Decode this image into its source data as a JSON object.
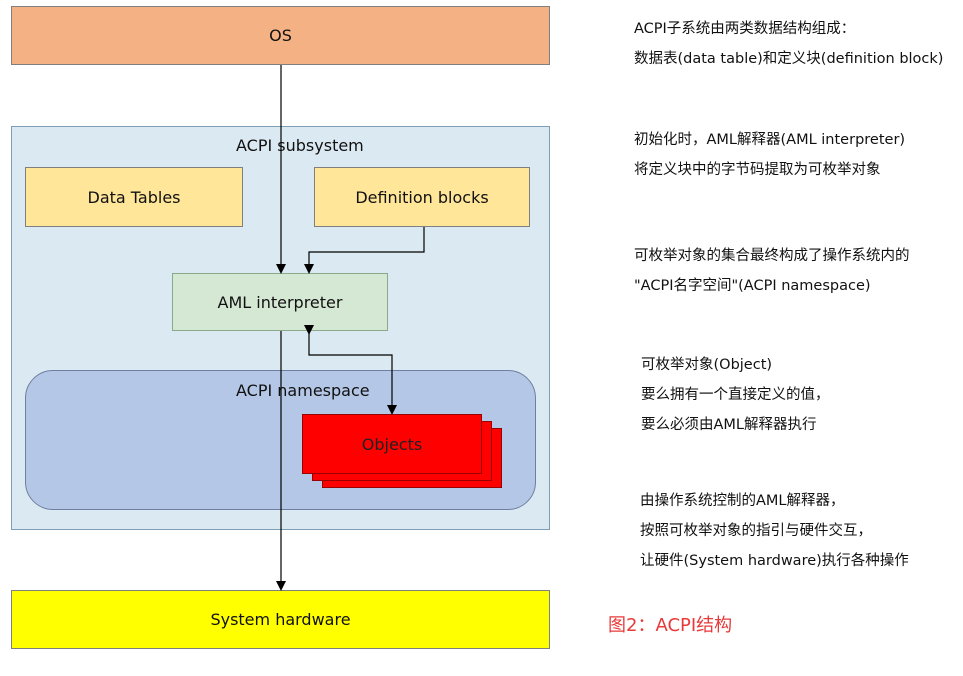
{
  "diagram": {
    "os_label": "OS",
    "subsystem_label": "ACPI subsystem",
    "data_tables_label": "Data Tables",
    "definition_blocks_label": "Definition blocks",
    "aml_interpreter_label": "AML interpreter",
    "namespace_label": "ACPI namespace",
    "objects_label": "Objects",
    "hardware_label": "System hardware",
    "colors": {
      "os": "#f4b183",
      "subsystem": "#dbeaf2",
      "tables": "#ffe699",
      "interpreter": "#d5e8d4",
      "namespace": "#b4c7e7",
      "objects": "#ff0000",
      "hardware": "#ffff00"
    }
  },
  "notes": [
    [
      "ACPI子系统由两类数据结构组成：",
      "数据表(data table)和定义块(definition block)"
    ],
    [
      "初始化时，AML解释器(AML interpreter)",
      "将定义块中的字节码提取为可枚举对象"
    ],
    [
      "可枚举对象的集合最终构成了操作系统内的",
      "\"ACPI名字空间\"(ACPI namespace)"
    ],
    [
      "可枚举对象(Object)",
      "要么拥有一个直接定义的值，",
      "要么必须由AML解释器执行"
    ],
    [
      "由操作系统控制的AML解释器，",
      "按照可枚举对象的指引与硬件交互，",
      "让硬件(System hardware)执行各种操作"
    ]
  ],
  "caption": "图2：ACPI结构",
  "caption_color": "#e83a3a"
}
